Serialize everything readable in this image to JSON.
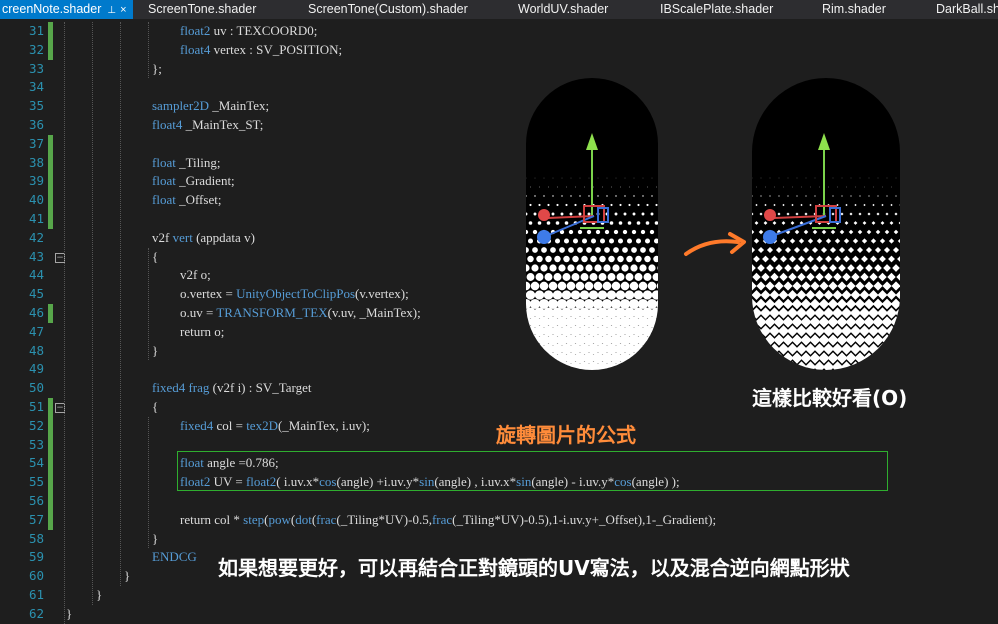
{
  "tabs": [
    {
      "label": "creenNote.shader",
      "active": true
    },
    {
      "label": "ScreenTone.shader",
      "active": false
    },
    {
      "label": "ScreenTone(Custom).shader",
      "active": false
    },
    {
      "label": "WorldUV.shader",
      "active": false
    },
    {
      "label": "IBScalePlate.shader",
      "active": false
    },
    {
      "label": "Rim.shader",
      "active": false
    },
    {
      "label": "DarkBall.sh",
      "active": false
    }
  ],
  "pin_glyph": "⊥",
  "close_glyph": "×",
  "fold_glyph": "−",
  "line_numbers": [
    "31",
    "32",
    "33",
    "34",
    "35",
    "36",
    "37",
    "38",
    "39",
    "40",
    "41",
    "42",
    "43",
    "44",
    "45",
    "46",
    "47",
    "48",
    "49",
    "50",
    "51",
    "52",
    "53",
    "54",
    "55",
    "56",
    "57",
    "58",
    "59",
    "60",
    "61",
    "62"
  ],
  "code_lines": [
    {
      "indent": 3,
      "tokens": [
        {
          "t": "float2",
          "c": "kw"
        },
        {
          "t": " uv : TEXCOORD0;",
          "c": ""
        }
      ]
    },
    {
      "indent": 3,
      "tokens": [
        {
          "t": "float4",
          "c": "kw"
        },
        {
          "t": " vertex : SV_POSITION;",
          "c": ""
        }
      ]
    },
    {
      "indent": 2,
      "tokens": [
        {
          "t": "};",
          "c": ""
        }
      ]
    },
    {
      "indent": 0,
      "tokens": []
    },
    {
      "indent": 2,
      "tokens": [
        {
          "t": "sampler2D",
          "c": "kw"
        },
        {
          "t": " _MainTex;",
          "c": ""
        }
      ]
    },
    {
      "indent": 2,
      "tokens": [
        {
          "t": "float4",
          "c": "kw"
        },
        {
          "t": " _MainTex_ST;",
          "c": ""
        }
      ]
    },
    {
      "indent": 0,
      "tokens": []
    },
    {
      "indent": 2,
      "tokens": [
        {
          "t": "float",
          "c": "kw"
        },
        {
          "t": " _Tiling;",
          "c": ""
        }
      ]
    },
    {
      "indent": 2,
      "tokens": [
        {
          "t": "float",
          "c": "kw"
        },
        {
          "t": " _Gradient;",
          "c": ""
        }
      ]
    },
    {
      "indent": 2,
      "tokens": [
        {
          "t": "float",
          "c": "kw"
        },
        {
          "t": " _Offset;",
          "c": ""
        }
      ]
    },
    {
      "indent": 0,
      "tokens": []
    },
    {
      "indent": 2,
      "tokens": [
        {
          "t": "v2f ",
          "c": ""
        },
        {
          "t": "vert",
          "c": "kw"
        },
        {
          "t": " (appdata v)",
          "c": ""
        }
      ]
    },
    {
      "indent": 2,
      "tokens": [
        {
          "t": "{",
          "c": ""
        }
      ]
    },
    {
      "indent": 3,
      "tokens": [
        {
          "t": "v2f o;",
          "c": ""
        }
      ]
    },
    {
      "indent": 3,
      "tokens": [
        {
          "t": "o.vertex = ",
          "c": ""
        },
        {
          "t": "UnityObjectToClipPos",
          "c": "fn"
        },
        {
          "t": "(v.vertex);",
          "c": ""
        }
      ]
    },
    {
      "indent": 3,
      "tokens": [
        {
          "t": "o.uv = ",
          "c": ""
        },
        {
          "t": "TRANSFORM_TEX",
          "c": "mac"
        },
        {
          "t": "(v.uv, _MainTex);",
          "c": ""
        }
      ]
    },
    {
      "indent": 3,
      "tokens": [
        {
          "t": "return o;",
          "c": ""
        }
      ]
    },
    {
      "indent": 2,
      "tokens": [
        {
          "t": "}",
          "c": ""
        }
      ]
    },
    {
      "indent": 0,
      "tokens": []
    },
    {
      "indent": 2,
      "tokens": [
        {
          "t": "fixed4",
          "c": "kw"
        },
        {
          "t": " ",
          "c": ""
        },
        {
          "t": "frag",
          "c": "kw"
        },
        {
          "t": " (v2f i) : SV_Target",
          "c": ""
        }
      ]
    },
    {
      "indent": 2,
      "tokens": [
        {
          "t": "{",
          "c": ""
        }
      ]
    },
    {
      "indent": 3,
      "tokens": [
        {
          "t": "fixed4",
          "c": "kw"
        },
        {
          "t": " col = ",
          "c": ""
        },
        {
          "t": "tex2D",
          "c": "fn"
        },
        {
          "t": "(_MainTex, i.uv);",
          "c": ""
        }
      ]
    },
    {
      "indent": 0,
      "tokens": []
    },
    {
      "indent": 3,
      "tokens": [
        {
          "t": "float",
          "c": "kw"
        },
        {
          "t": " angle =0.786;",
          "c": ""
        }
      ]
    },
    {
      "indent": 3,
      "tokens": [
        {
          "t": "float2",
          "c": "kw"
        },
        {
          "t": " UV = ",
          "c": ""
        },
        {
          "t": "float2",
          "c": "kw"
        },
        {
          "t": "( i.uv.x*",
          "c": ""
        },
        {
          "t": "cos",
          "c": "fn"
        },
        {
          "t": "(angle) +i.uv.y*",
          "c": ""
        },
        {
          "t": "sin",
          "c": "fn"
        },
        {
          "t": "(angle) , i.uv.x*",
          "c": ""
        },
        {
          "t": "sin",
          "c": "fn"
        },
        {
          "t": "(angle) - i.uv.y*",
          "c": ""
        },
        {
          "t": "cos",
          "c": "fn"
        },
        {
          "t": "(angle) );",
          "c": ""
        }
      ]
    },
    {
      "indent": 0,
      "tokens": []
    },
    {
      "indent": 3,
      "tokens": [
        {
          "t": "return col * ",
          "c": ""
        },
        {
          "t": "step",
          "c": "fn"
        },
        {
          "t": "(",
          "c": ""
        },
        {
          "t": "pow",
          "c": "fn"
        },
        {
          "t": "(",
          "c": ""
        },
        {
          "t": "dot",
          "c": "fn"
        },
        {
          "t": "(",
          "c": ""
        },
        {
          "t": "frac",
          "c": "fn"
        },
        {
          "t": "(_Tiling*UV)-0.5,",
          "c": ""
        },
        {
          "t": "frac",
          "c": "fn"
        },
        {
          "t": "(_Tiling*UV)-0.5),1-i.uv.y+_Offset),1-_Gradient);",
          "c": ""
        }
      ]
    },
    {
      "indent": 2,
      "tokens": [
        {
          "t": "}",
          "c": ""
        }
      ]
    },
    {
      "indent": 2,
      "tokens": [
        {
          "t": "ENDCG",
          "c": "kw"
        }
      ]
    },
    {
      "indent": 1,
      "tokens": [
        {
          "t": "}",
          "c": ""
        }
      ]
    },
    {
      "indent": 0.5,
      "tokens": [
        {
          "t": "}",
          "c": ""
        }
      ]
    },
    {
      "indent": 0,
      "tokens": [
        {
          "t": "}",
          "c": ""
        }
      ]
    }
  ],
  "captions": {
    "compare": "這樣比較好看(O)",
    "rotate": "旋轉圖片的公式",
    "better": "如果想要更好，可以再結合正對鏡頭的UV寫法，以及混合逆向網點形狀"
  },
  "colors": {
    "keyword": "#569cd6",
    "line_number": "#2b91af",
    "change_marker": "#57a64a",
    "highlight_box": "#2fae2f",
    "arrow": "#ff7a2a",
    "caption_orange": "#ff8c3a"
  }
}
